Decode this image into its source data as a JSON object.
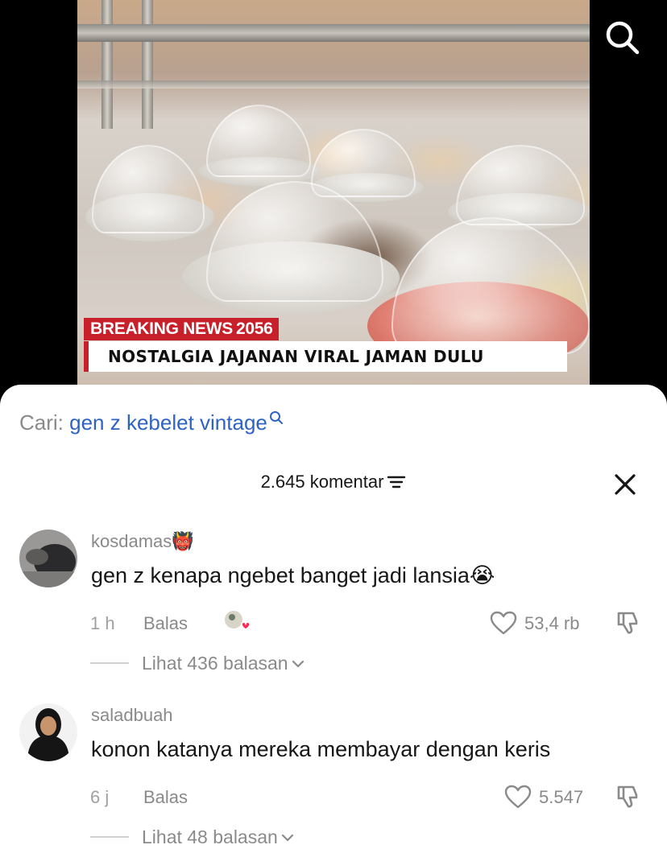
{
  "video": {
    "breaking_label": "BREAKING NEWS",
    "breaking_year": "2056",
    "headline": "NOSTALGIA JAJANAN VIRAL JAMAN DULU"
  },
  "search_suggestion": {
    "prefix": "Cari:",
    "query": "gen z kebelet vintage"
  },
  "comments_header": {
    "count_label": "2.645 komentar"
  },
  "comments": [
    {
      "username": "kosdamas",
      "username_emoji": "👹",
      "text": "gen z kenapa ngebet banget jadi lansia",
      "text_emoji": "😭",
      "time": "1 h",
      "reply_label": "Balas",
      "likes": "53,4 rb",
      "view_replies": "Lihat 436 balasan"
    },
    {
      "username": "saladbuah",
      "text": "konon katanya mereka membayar dengan keris",
      "time": "6 j",
      "reply_label": "Balas",
      "likes": "5.547",
      "view_replies": "Lihat 48 balasan"
    }
  ],
  "colors": {
    "accent_link": "#2e63c4",
    "breaking_red": "#c8202a",
    "muted_text": "#8a8a8a"
  },
  "icons": [
    "search-icon",
    "filter-icon",
    "close-icon",
    "heart-icon",
    "dislike-icon",
    "chevron-down-icon"
  ]
}
